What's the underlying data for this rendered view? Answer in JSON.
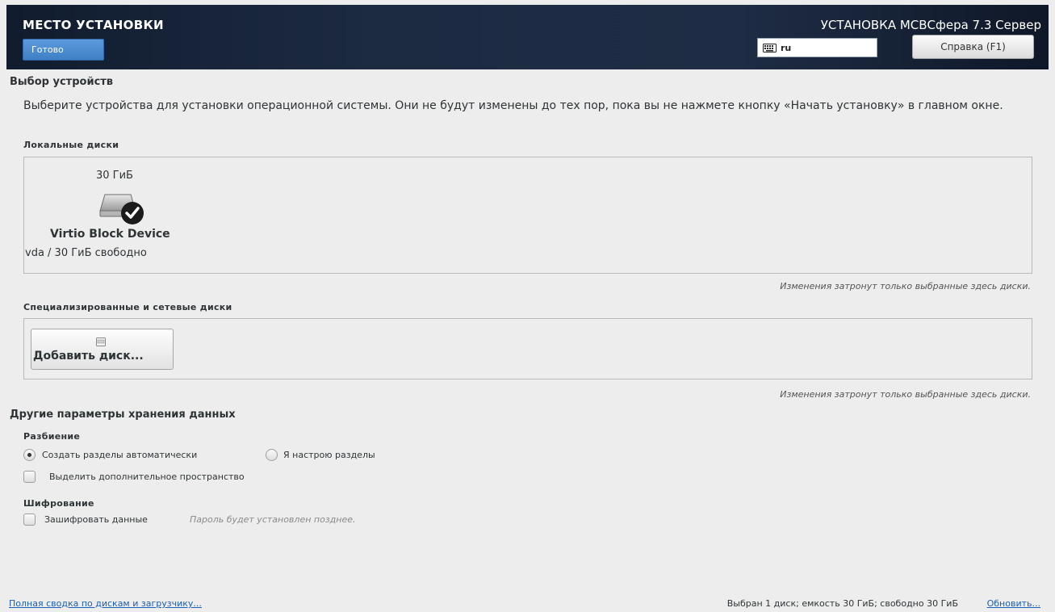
{
  "header": {
    "title": "МЕСТО УСТАНОВКИ",
    "done_label": "Готово",
    "product": "УСТАНОВКА МСВСфера 7.3 Сервер",
    "keyboard_layout": "ru",
    "help_label": "Справка (F1)"
  },
  "device_selection": {
    "title": "Выбор устройств",
    "description": "Выберите устройства для установки операционной системы. Они не будут изменены до тех пор, пока вы не нажмете кнопку «Начать установку» в главном окне.",
    "local_disks": {
      "title": "Локальные диски",
      "disks": [
        {
          "size": "30 ГиБ",
          "name": "Virtio Block Device",
          "free": "vda  /  30 ГиБ свободно",
          "selected": true
        }
      ],
      "note": "Изменения затронут только выбранные здесь диски."
    },
    "network_disks": {
      "title": "Специализированные и сетевые диски",
      "add_label": "Добавить диск...",
      "note": "Изменения затронут только выбранные здесь диски."
    }
  },
  "storage_options": {
    "title": "Другие параметры хранения данных",
    "partitioning": {
      "title": "Разбиение",
      "auto_label": "Создать разделы автоматически",
      "manual_label": "Я настрою разделы",
      "selected": "auto",
      "extra_space_label": "Выделить дополнительное пространство",
      "extra_space_checked": false
    },
    "encryption": {
      "title": "Шифрование",
      "encrypt_label": "Зашифровать данные",
      "encrypt_checked": false,
      "hint": "Пароль будет установлен позднее."
    }
  },
  "footer": {
    "summary_link": "Полная сводка по дискам и загрузчику...",
    "status": "Выбран 1 диск; емкость 30 ГиБ; свободно 30 ГиБ",
    "refresh_link": "Обновить..."
  },
  "colors": {
    "header_bg": "#1c2a42",
    "accent_blue": "#3f7fc4",
    "link": "#1a5fb4",
    "page_bg": "#ededed"
  }
}
